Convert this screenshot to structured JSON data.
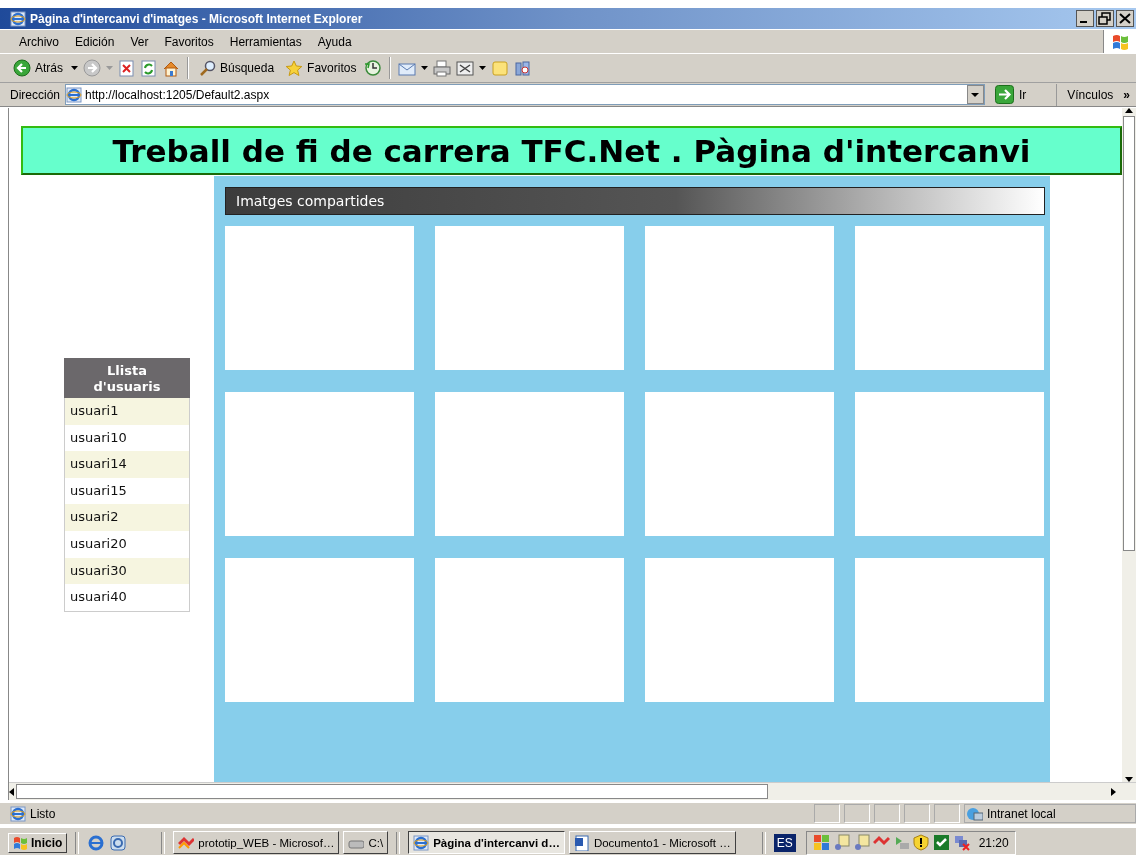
{
  "window": {
    "title": "Pàgina d'intercanvi d'imatges - Microsoft Internet Explorer"
  },
  "menu": [
    "Archivo",
    "Edición",
    "Ver",
    "Favoritos",
    "Herramientas",
    "Ayuda"
  ],
  "toolbar": {
    "back": {
      "label": "Atrás"
    },
    "forward": {
      "disabled": true
    },
    "search": {
      "label": "Búsqueda"
    },
    "favorites": {
      "label": "Favoritos"
    }
  },
  "address_bar": {
    "label": "Dirección",
    "value": "http://localhost:1205/Default2.aspx",
    "go": "Ir",
    "links": "Vínculos",
    "more": "»"
  },
  "page": {
    "banner": "Treball de fi de carrera TFC.Net . Pàgina d'intercanvi",
    "user_list": {
      "title": "Llista d'usuaris",
      "users": [
        "usuari1",
        "usuari10",
        "usuari14",
        "usuari15",
        "usuari2",
        "usuari20",
        "usuari30",
        "usuari40"
      ]
    },
    "gallery": {
      "title": "Imatges compartides",
      "tiles": [
        {
          "kind": "blank"
        },
        {
          "kind": "blank"
        },
        {
          "kind": "blank"
        },
        {
          "kind": "blank"
        },
        {
          "kind": "blank"
        },
        {
          "kind": "blank"
        },
        {
          "kind": "blank"
        },
        {
          "kind": "blank"
        },
        {
          "kind": "blank"
        },
        {
          "kind": "blank"
        },
        {
          "kind": "blank"
        },
        {
          "kind": "blank"
        }
      ]
    }
  },
  "status_bar": {
    "text": "Listo",
    "zone": "Intranet local"
  },
  "taskbar": {
    "start": "Inicio",
    "tasks": [
      {
        "label": "prototip_WEB - Microsof…",
        "selected": false
      },
      {
        "label": "C:\\",
        "selected": false
      },
      {
        "label": "Pàgina d'intercanvi d…",
        "selected": true
      },
      {
        "label": "Documento1 - Microsoft …",
        "selected": false
      }
    ],
    "language": "ES",
    "clock": "21:20"
  }
}
